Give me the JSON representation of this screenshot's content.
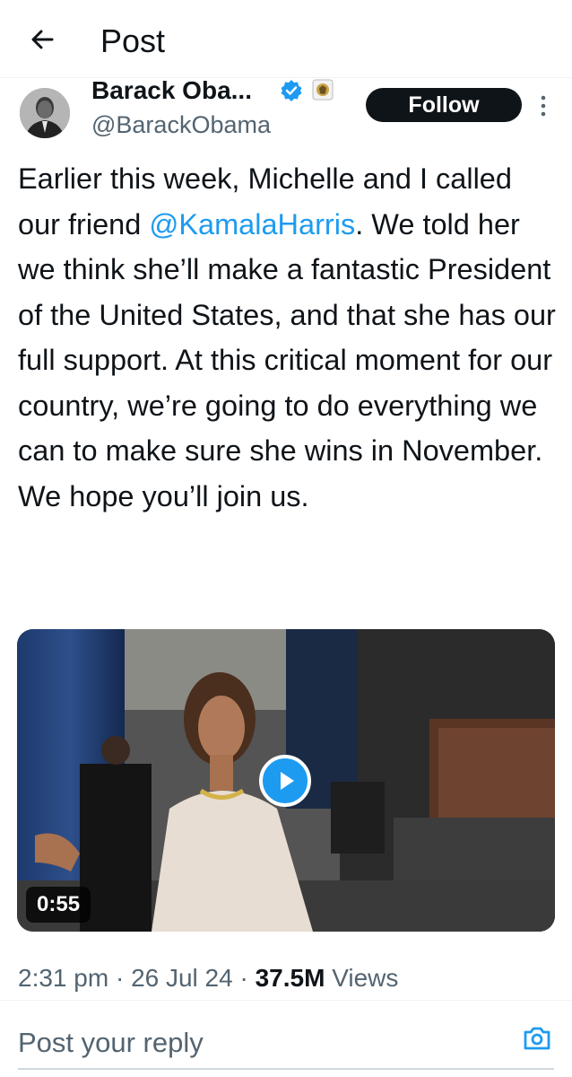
{
  "header": {
    "title": "Post"
  },
  "author": {
    "name": "Barack Oba...",
    "handle": "@BarackObama"
  },
  "actions": {
    "follow_label": "Follow"
  },
  "tweet": {
    "text_before": "Earlier this week, Michelle and I called our friend ",
    "mention": "@KamalaHarris",
    "text_after": ". We told her we think she’ll make a fantastic President of the United States, and that she has our full support. At this critical moment for our country, we’re going to do everything we can to make sure she wins in November. We hope you’ll join us."
  },
  "media": {
    "duration": "0:55"
  },
  "meta": {
    "time": "2:31 pm",
    "date": "26 Jul 24",
    "views_count": "37.5M",
    "views_label": "Views",
    "separator": "·"
  },
  "reply": {
    "placeholder": "Post your reply"
  },
  "colors": {
    "accent": "#1d9bf0",
    "text": "#0f1419",
    "secondary": "#536471",
    "button_bg": "#0f1419"
  },
  "icons": [
    "back-arrow-icon",
    "verified-badge-icon",
    "government-affiliation-icon",
    "more-options-icon",
    "play-icon",
    "camera-icon"
  ]
}
